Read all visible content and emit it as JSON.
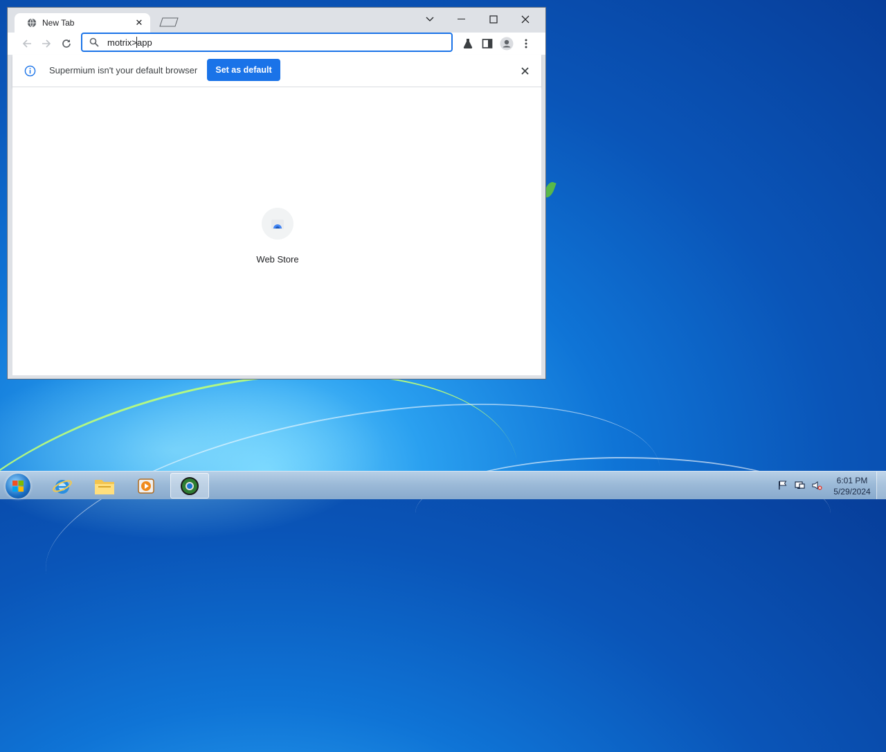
{
  "browser": {
    "tab_title": "New Tab",
    "omnibox_value": "motrix>app",
    "infobar": {
      "message": "Supermium isn't your default browser",
      "button_label": "Set as default"
    },
    "shortcuts": [
      {
        "label": "Web Store",
        "icon": "web-store-icon"
      }
    ],
    "accent_color": "#1a73e8"
  },
  "taskbar": {
    "apps": [
      "internet-explorer",
      "file-explorer",
      "media-player",
      "supermium"
    ],
    "active_app": "supermium",
    "clock": {
      "time": "6:01 PM",
      "date": "5/29/2024"
    }
  }
}
